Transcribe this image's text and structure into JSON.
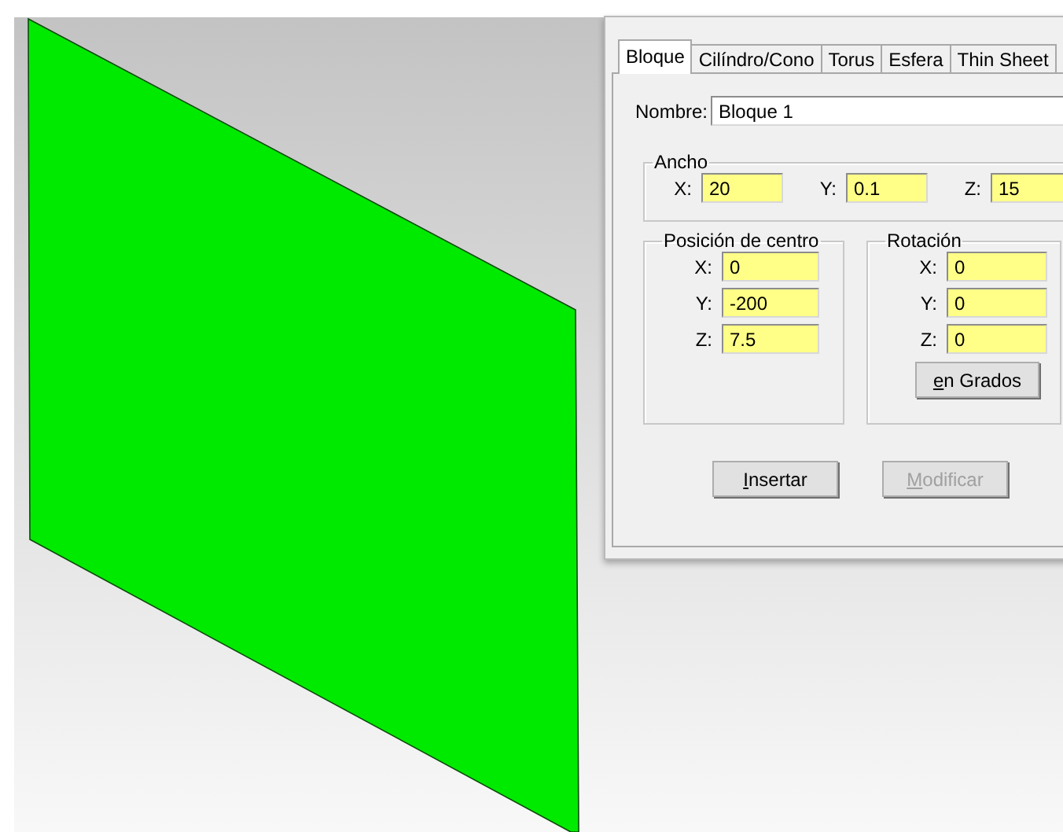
{
  "tabs": [
    {
      "label": "Bloque",
      "selected": true
    },
    {
      "label": "Cilíndro/Cono",
      "selected": false
    },
    {
      "label": "Torus",
      "selected": false
    },
    {
      "label": "Esfera",
      "selected": false
    },
    {
      "label": "Thin Sheet",
      "selected": false
    }
  ],
  "name_field": {
    "label": "Nombre:",
    "value": "Bloque 1"
  },
  "size_group": {
    "title": "Ancho",
    "fields": [
      {
        "label": "X:",
        "value": "20"
      },
      {
        "label": "Y:",
        "value": "0.1"
      },
      {
        "label": "Z:",
        "value": "15"
      }
    ]
  },
  "center_group": {
    "title": "Posición de centro",
    "fields": [
      {
        "label": "X:",
        "value": "0"
      },
      {
        "label": "Y:",
        "value": "-200"
      },
      {
        "label": "Z:",
        "value": "7.5"
      }
    ]
  },
  "rotation_group": {
    "title": "Rotación",
    "fields": [
      {
        "label": "X:",
        "value": "0"
      },
      {
        "label": "Y:",
        "value": "0"
      },
      {
        "label": "Z:",
        "value": "0"
      }
    ],
    "button": "en Grados"
  },
  "buttons": [
    {
      "label": "Insertar",
      "disabled": false
    },
    {
      "label": "Modificar",
      "disabled": true
    }
  ]
}
